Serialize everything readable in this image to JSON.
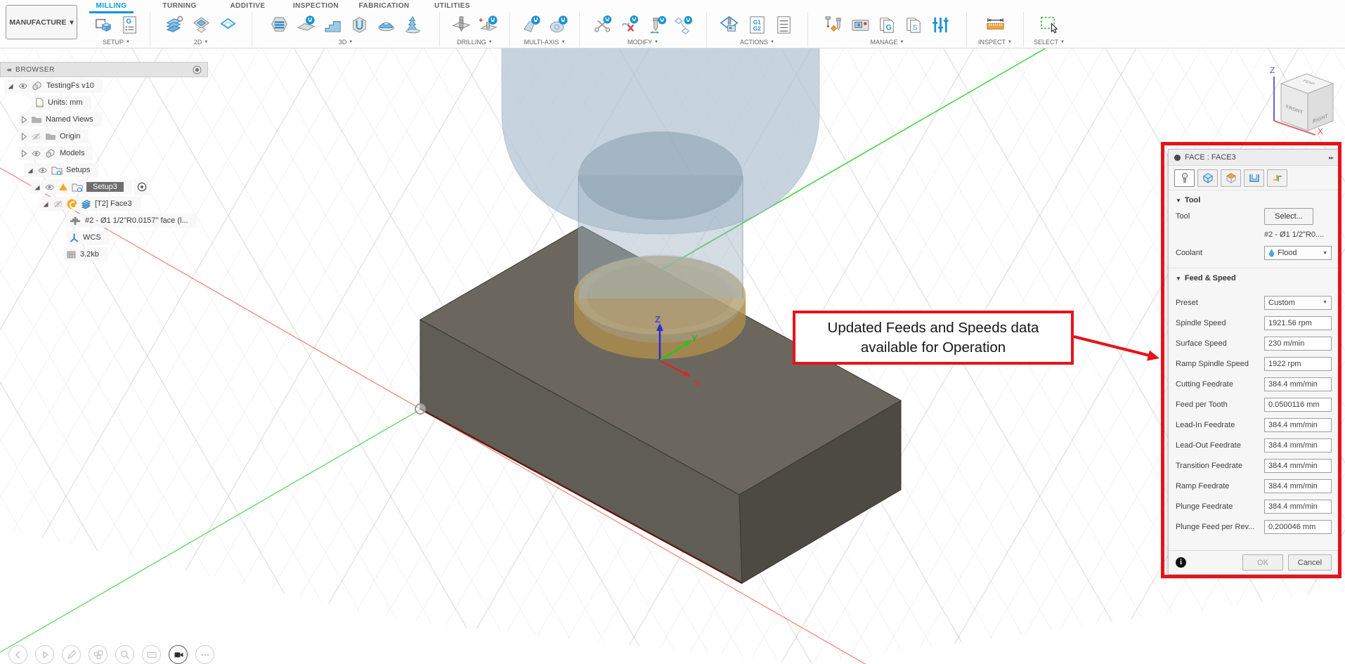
{
  "app": {
    "workspace_switcher": "MANUFACTURE",
    "tabs": [
      {
        "label": "MILLING",
        "active": true
      },
      {
        "label": "TURNING",
        "active": false
      },
      {
        "label": "ADDITIVE",
        "active": false
      },
      {
        "label": "INSPECTION",
        "active": false
      },
      {
        "label": "FABRICATION",
        "active": false
      },
      {
        "label": "UTILITIES",
        "active": false
      }
    ]
  },
  "toolbar": {
    "groups": [
      {
        "label": "SETUP"
      },
      {
        "label": "2D"
      },
      {
        "label": "3D"
      },
      {
        "label": "DRILLING"
      },
      {
        "label": "MULTI-AXIS"
      },
      {
        "label": "MODIFY"
      },
      {
        "label": "ACTIONS"
      },
      {
        "label": "MANAGE"
      },
      {
        "label": "INSPECT"
      },
      {
        "label": "SELECT"
      }
    ]
  },
  "browser": {
    "title": "BROWSER",
    "rows": [
      {
        "label": "TestingFs v10"
      },
      {
        "label": "Units: mm"
      },
      {
        "label": "Named Views"
      },
      {
        "label": "Origin"
      },
      {
        "label": "Models"
      },
      {
        "label": "Setups"
      },
      {
        "label": "Setup3"
      },
      {
        "label": "[T2] Face3"
      },
      {
        "label": "#2 - Ø1 1/2\"R0.0157\" face (l..."
      },
      {
        "label": "WCS"
      },
      {
        "label": "3.2kb"
      }
    ]
  },
  "viewport": {
    "viewcube": {
      "top": "TOP",
      "front": "FRONT",
      "right": "RIGHT",
      "z_label": "Z",
      "x_label": "X"
    },
    "triad": {
      "x": "X",
      "y": "Y",
      "z": "Z"
    }
  },
  "annotation": {
    "line1": "Updated Feeds and Speeds data",
    "line2": "available for Operation",
    "color": "#e6131c"
  },
  "dialog": {
    "title": "FACE : FACE3",
    "tool_section": {
      "header": "Tool",
      "tool_label": "Tool",
      "select_button": "Select...",
      "tool_name": "#2 - Ø1 1/2\"R0....",
      "coolant_label": "Coolant",
      "coolant_value": "Flood"
    },
    "feed_section": {
      "header": "Feed & Speed",
      "rows": [
        {
          "label": "Preset",
          "value": "Custom"
        },
        {
          "label": "Spindle Speed",
          "value": "1921.56 rpm"
        },
        {
          "label": "Surface Speed",
          "value": "230 m/min"
        },
        {
          "label": "Ramp Spindle Speed",
          "value": "1922 rpm"
        },
        {
          "label": "Cutting Feedrate",
          "value": "384.4 mm/min"
        },
        {
          "label": "Feed per Tooth",
          "value": "0.0500116 mm"
        },
        {
          "label": "Lead-In Feedrate",
          "value": "384.4 mm/min"
        },
        {
          "label": "Lead-Out Feedrate",
          "value": "384.4 mm/min"
        },
        {
          "label": "Transition Feedrate",
          "value": "384.4 mm/min"
        },
        {
          "label": "Ramp Feedrate",
          "value": "384.4 mm/min"
        },
        {
          "label": "Plunge Feedrate",
          "value": "384.4 mm/min"
        },
        {
          "label": "Plunge Feed per Rev...",
          "value": "0.200046 mm"
        }
      ]
    },
    "footer": {
      "ok": "OK",
      "cancel": "Cancel"
    }
  },
  "icons": {
    "workspace_caret": "▾",
    "group_caret": "▼",
    "collapse_left": "◂◂",
    "pin_right": "▸▸",
    "section_caret": "▼",
    "select_caret": "▼",
    "info": "i"
  },
  "colors": {
    "accent": "#0696d7",
    "annotation_red": "#e6131c",
    "axis_x": "#d42b2b",
    "axis_y": "#27c427",
    "axis_z": "#2b2bd4"
  }
}
